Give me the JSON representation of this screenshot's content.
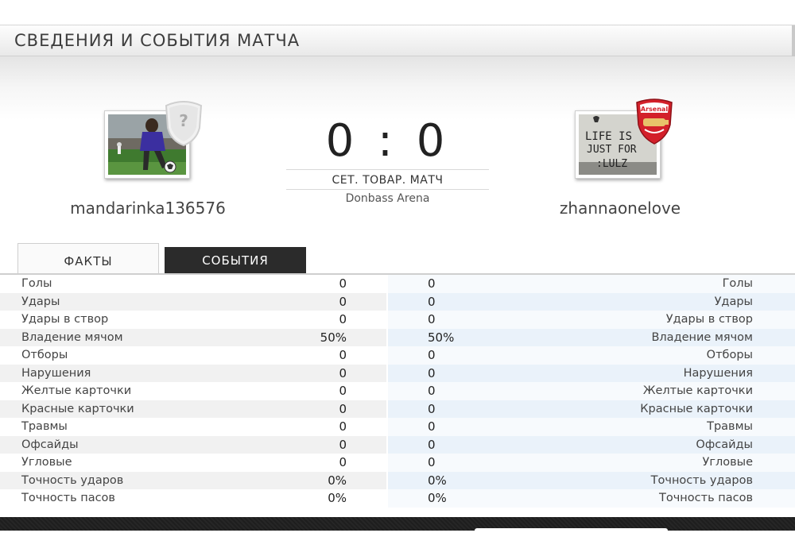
{
  "header": {
    "title": "СВЕДЕНИЯ И СОБЫТИЯ МАТЧА"
  },
  "match": {
    "score": "0 : 0",
    "type": "СЕТ. ТОВАР. МАТЧ",
    "stadium": "Donbass Arena"
  },
  "home": {
    "name": "mandarinka136576",
    "crest_icon": "unknown-club-shield-icon",
    "crest_text": "?"
  },
  "away": {
    "name": "zhannaonelove",
    "crest_icon": "arsenal-crest-icon",
    "crest_text": "Arsenal",
    "avatar_text": [
      "LIFE IS",
      "JUST FOR",
      ":LULZ"
    ]
  },
  "tabs": [
    {
      "label": "ФАКТЫ",
      "active": true
    },
    {
      "label": "СОБЫТИЯ",
      "active": false
    }
  ],
  "stats": [
    {
      "label": "Голы",
      "home": "0",
      "away": "0"
    },
    {
      "label": "Удары",
      "home": "0",
      "away": "0"
    },
    {
      "label": "Удары в створ",
      "home": "0",
      "away": "0"
    },
    {
      "label": "Владение мячом",
      "home": "50%",
      "away": "50%"
    },
    {
      "label": "Отборы",
      "home": "0",
      "away": "0"
    },
    {
      "label": "Нарушения",
      "home": "0",
      "away": "0"
    },
    {
      "label": "Желтые карточки",
      "home": "0",
      "away": "0"
    },
    {
      "label": "Красные карточки",
      "home": "0",
      "away": "0"
    },
    {
      "label": "Травмы",
      "home": "0",
      "away": "0"
    },
    {
      "label": "Офсайды",
      "home": "0",
      "away": "0"
    },
    {
      "label": "Угловые",
      "home": "0",
      "away": "0"
    },
    {
      "label": "Точность ударов",
      "home": "0%",
      "away": "0%"
    },
    {
      "label": "Точность пасов",
      "home": "0%",
      "away": "0%"
    }
  ],
  "colors": {
    "accent_dark": "#2b2b2b",
    "arsenal_red": "#d3202a",
    "row_blue": "#eaf2fa"
  }
}
